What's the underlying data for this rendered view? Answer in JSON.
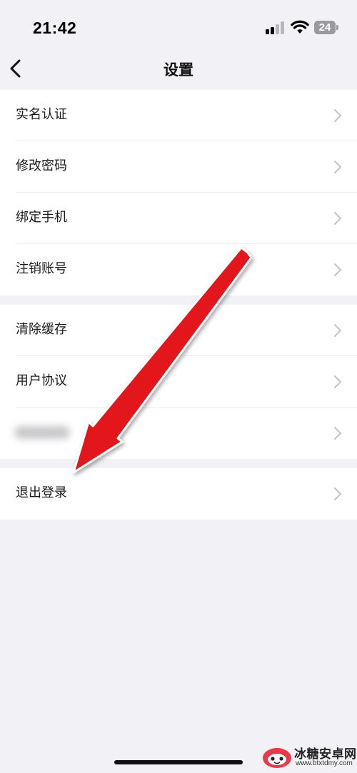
{
  "status_bar": {
    "time": "21:42",
    "battery": "24"
  },
  "nav": {
    "title": "设置",
    "back_icon": "chevron-left-icon"
  },
  "groups": [
    {
      "items": [
        {
          "label": "实名认证"
        },
        {
          "label": "修改密码"
        },
        {
          "label": "绑定手机"
        },
        {
          "label": "注销账号"
        }
      ]
    },
    {
      "items": [
        {
          "label": "清除缓存"
        },
        {
          "label": "用户协议"
        },
        {
          "label": ""
        }
      ]
    },
    {
      "items": [
        {
          "label": "退出登录"
        }
      ]
    }
  ],
  "annotation": {
    "type": "red-arrow",
    "color": "#e3141b",
    "points_to": "退出登录"
  },
  "watermark": {
    "name": "冰糖安卓网",
    "url": "www.btxtdmy.com"
  },
  "colors": {
    "background": "#f2f2f6",
    "card": "#ffffff",
    "chevron": "#c4c4c8",
    "arrow": "#e3141b"
  }
}
